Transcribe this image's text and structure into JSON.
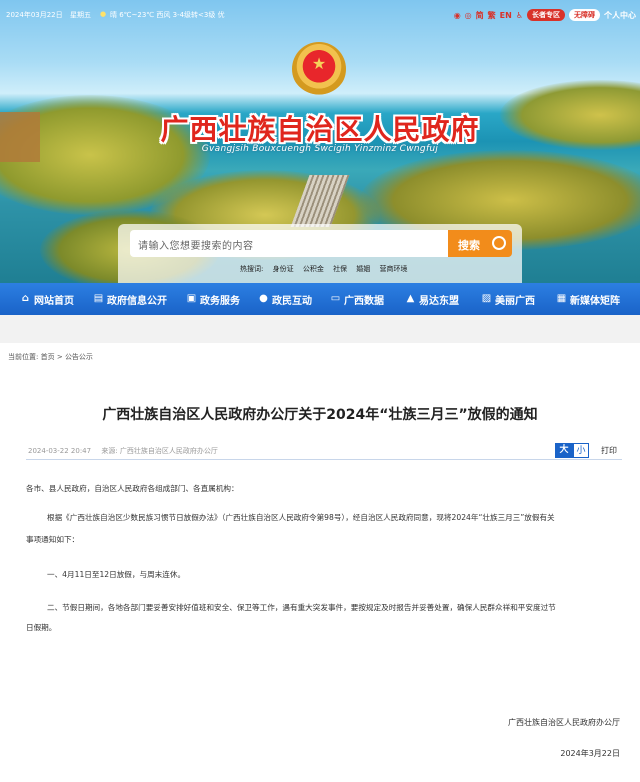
{
  "topbar": {
    "date": "2024年03月22日",
    "weekday": "星期五",
    "weather": "晴 6℃~23℃ 西风 3-4级转<3级 优",
    "links": [
      "简",
      "繁",
      "EN"
    ],
    "elder_zone": "长者专区",
    "accessibility": "无障碍",
    "personal_center": "个人中心"
  },
  "header": {
    "title": "广西壮族自治区人民政府",
    "subtitle": "Gvangjsih Bouxcuengh Swcigih Yinzminz Cwngfuj"
  },
  "search": {
    "placeholder": "请输入您想要搜索的内容",
    "button_label": "搜索",
    "hot_label": "热搜词:",
    "hot_words": [
      "身份证",
      "公积金",
      "社保",
      "婚姻",
      "营商环境"
    ]
  },
  "nav": {
    "items": [
      {
        "label": "网站首页",
        "icon": "home-icon"
      },
      {
        "label": "政府信息公开",
        "icon": "document-icon"
      },
      {
        "label": "政务服务",
        "icon": "service-icon"
      },
      {
        "label": "政民互动",
        "icon": "chat-icon"
      },
      {
        "label": "广西数据",
        "icon": "data-icon"
      },
      {
        "label": "易达东盟",
        "icon": "landmark-icon"
      },
      {
        "label": "美丽广西",
        "icon": "landscape-icon"
      },
      {
        "label": "新媒体矩阵",
        "icon": "media-icon"
      }
    ]
  },
  "breadcrumb": {
    "prefix": "当前位置:",
    "home": "首页",
    "sep": ">",
    "current": "公告公示"
  },
  "article": {
    "title": "广西壮族自治区人民政府办公厅关于2024年“壮族三月三”放假的通知",
    "datetime": "2024-03-22 20:47",
    "source": "来源: 广西壮族自治区人民政府办公厅",
    "font_big": "大",
    "font_small": "小",
    "print": "打印",
    "salutation": "各市、县人民政府，自治区人民政府各组成部门、各直属机构：",
    "para1_line1": "根据《广西壮族自治区少数民族习惯节日放假办法》（广西壮族自治区人民政府令第98号），经自治区人民政府同意，现将2024年“壮族三月三”放假有关",
    "para1_line2": "事项通知如下：",
    "item1": "一、4月11日至12日放假，与周末连休。",
    "item2_line1": "二、节假日期间，各地各部门要妥善安排好值班和安全、保卫等工作，遇有重大突发事件，要按规定及时报告并妥善处置，确保人民群众祥和平安度过节",
    "item2_line2": "日假期。",
    "signature": "广西壮族自治区人民政府办公厅",
    "sign_date": "2024年3月22日"
  },
  "colors": {
    "brand_red": "#e0261d",
    "nav_blue": "#1a63c8",
    "search_orange": "#f28c1b"
  }
}
